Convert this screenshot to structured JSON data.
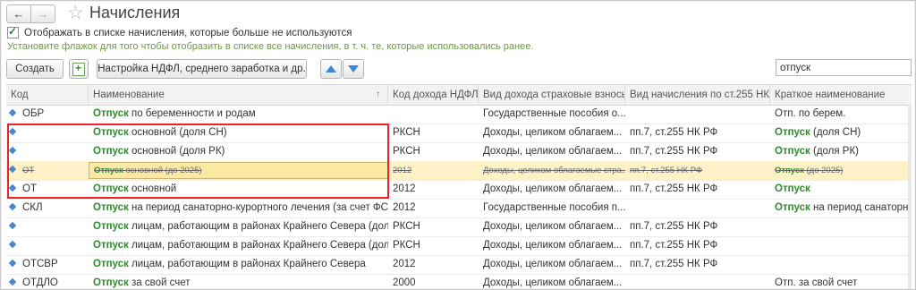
{
  "header": {
    "back_icon": "back-arrow-icon",
    "forward_icon": "forward-arrow-icon",
    "favorite_icon": "star-icon",
    "title": "Начисления"
  },
  "options": {
    "show_unused_label": "Отображать в списке начисления, которые больше не используются",
    "show_unused_checked": true,
    "hint": "Установите флажок для того чтобы отобразить в списке все начисления, в т. ч. те, которые использовались ранее."
  },
  "toolbar": {
    "create_label": "Создать",
    "copy_icon": "copy-add-icon",
    "settings_label": "Настройка НДФЛ, среднего заработка и др.",
    "move_up_icon": "arrow-up-icon",
    "move_down_icon": "arrow-down-icon",
    "search_value": "отпуск"
  },
  "table": {
    "columns": [
      "Код",
      "Наименование",
      "Код дохода НДФЛ",
      "Вид дохода страховые взносы",
      "Вид начисления по ст.255 НК",
      "Краткое наименование"
    ],
    "sort_indicator": "↑",
    "rows": [
      {
        "code": "ОБР",
        "hl": "Отпуск",
        "name": " по беременности и родам",
        "ndfl": "",
        "ins": "Государственные пособия о...",
        "art": "",
        "shortHl": "",
        "short": "Отп. по берем."
      },
      {
        "code": "",
        "hl": "Отпуск",
        "name": " основной (доля СН)",
        "ndfl": "РКСН",
        "ins": "Доходы, целиком облагаем...",
        "art": "пп.7, ст.255 НК РФ",
        "shortHl": "Отпуск",
        "short": " (доля СН)"
      },
      {
        "code": "",
        "hl": "Отпуск",
        "name": " основной (доля РК)",
        "ndfl": "РКСН",
        "ins": "Доходы, целиком облагаем...",
        "art": "пп.7, ст.255 НК РФ",
        "shortHl": "Отпуск",
        "short": " (доля РК)"
      },
      {
        "code": "ОТ",
        "hl": "Отпуск",
        "name": " основной (до 2025)",
        "ndfl": "2012",
        "ins": "Доходы, целиком облагаемые стра...",
        "art": "пп.7, ст.255 НК РФ",
        "shortHl": "Отпуск",
        "short": " (до 2025)"
      },
      {
        "code": "ОТ",
        "hl": "Отпуск",
        "name": " основной",
        "ndfl": "2012",
        "ins": "Доходы, целиком облагаем...",
        "art": "пп.7, ст.255 НК РФ",
        "shortHl": "Отпуск",
        "short": ""
      },
      {
        "code": "СКЛ",
        "hl": "Отпуск",
        "name": " на период санаторно-курортного лечения (за счет ФСС)",
        "ndfl": "2012",
        "ins": "Государственные пособия п...",
        "art": "",
        "shortHl": "Отпуск",
        "short": " на период санаторн"
      },
      {
        "code": "",
        "hl": "Отпуск",
        "name": " лицам, работающим в районах Крайнего Севера (дол...",
        "ndfl": "РКСН",
        "ins": "Доходы, целиком облагаем...",
        "art": "пп.7, ст.255 НК РФ",
        "shortHl": "",
        "short": ""
      },
      {
        "code": "",
        "hl": "Отпуск",
        "name": " лицам, работающим в районах Крайнего Севера (дол...",
        "ndfl": "РКСН",
        "ins": "Доходы, целиком облагаем...",
        "art": "пп.7, ст.255 НК РФ",
        "shortHl": "",
        "short": ""
      },
      {
        "code": "ОТСВР",
        "hl": "Отпуск",
        "name": " лицам, работающим в районах Крайнего Севера",
        "ndfl": "2012",
        "ins": "Доходы, целиком облагаем...",
        "art": "пп.7, ст.255 НК РФ",
        "shortHl": "",
        "short": ""
      },
      {
        "code": "ОТДЛО",
        "hl": "Отпуск",
        "name": " за свой счет",
        "ndfl": "2000",
        "ins": "Доходы, целиком облагаем...",
        "art": "",
        "shortHl": "",
        "short": "Отп. за свой счет"
      }
    ]
  },
  "highlight": {
    "strike_row_index": 3,
    "box_color": "#e8232a",
    "accent_color": "#2e8b2e"
  }
}
